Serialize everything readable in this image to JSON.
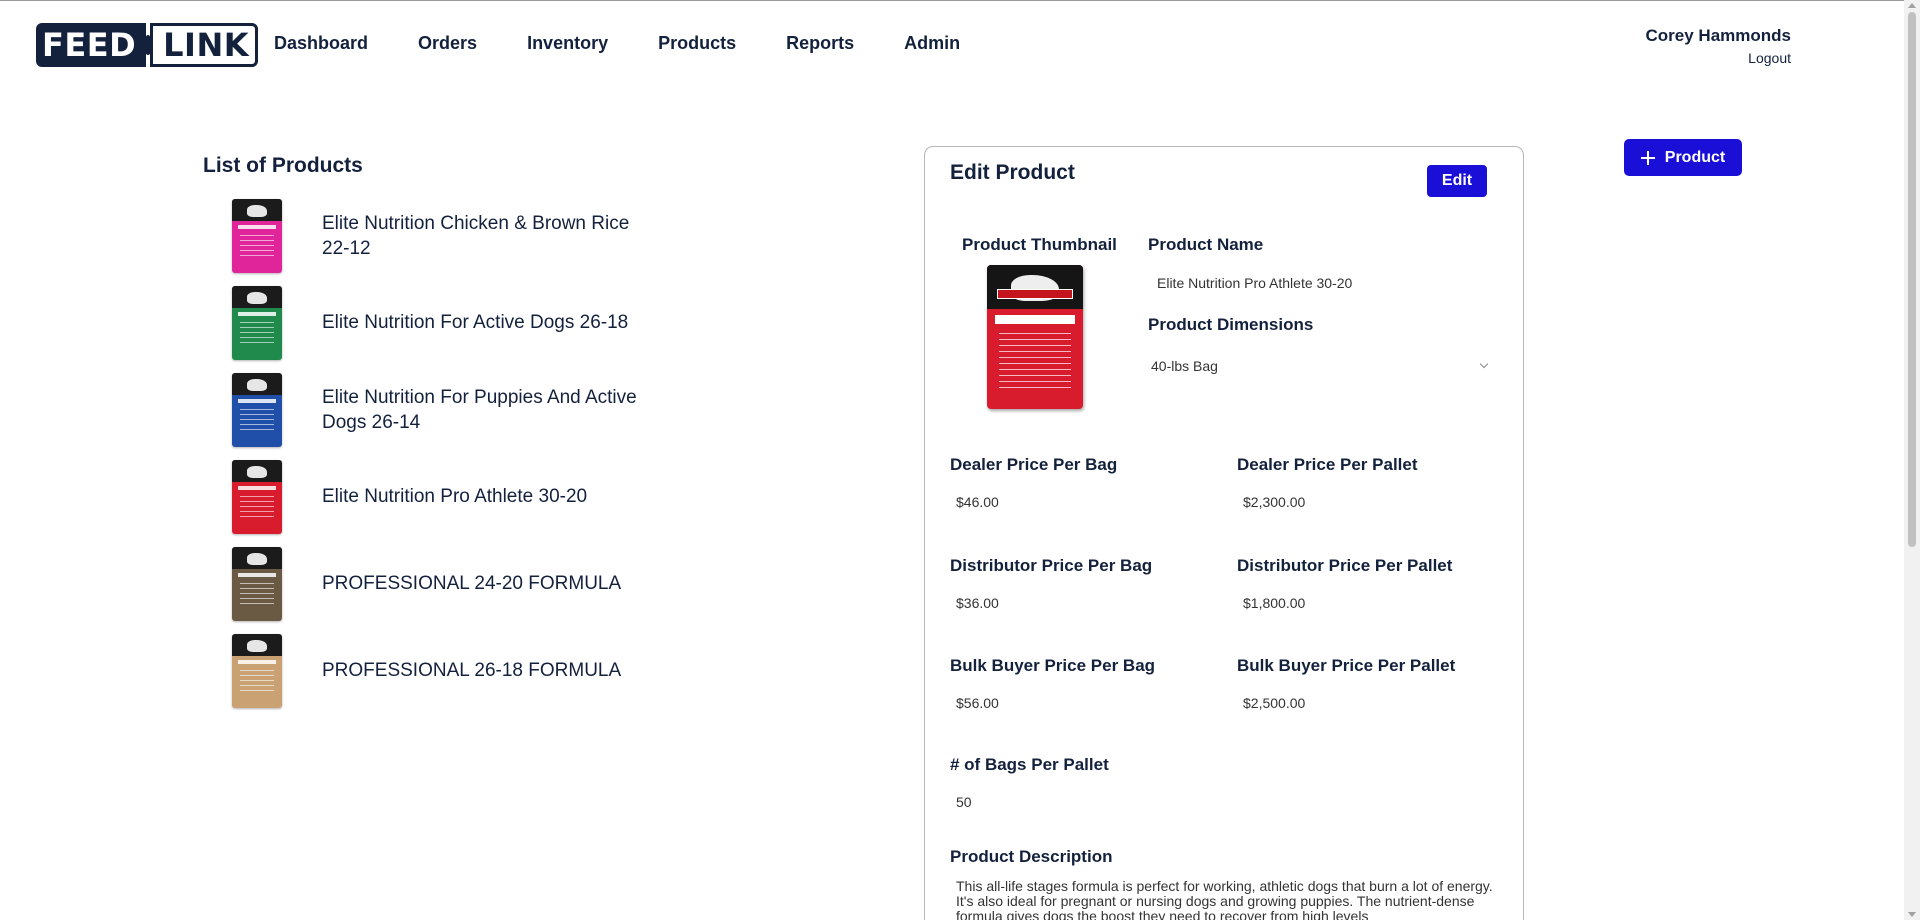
{
  "brand": {
    "part1": "FEED",
    "part2": "LINK"
  },
  "nav": [
    {
      "label": "Dashboard"
    },
    {
      "label": "Orders"
    },
    {
      "label": "Inventory"
    },
    {
      "label": "Products"
    },
    {
      "label": "Reports"
    },
    {
      "label": "Admin"
    }
  ],
  "user": {
    "name": "Corey Hammonds",
    "logout": "Logout"
  },
  "product_list": {
    "title": "List of Products",
    "items": [
      {
        "name": "Elite Nutrition Chicken & Brown Rice 22-12",
        "bag_color": "#e0259b"
      },
      {
        "name": " Elite Nutrition For Active Dogs 26-18",
        "bag_color": "#1f8a4c"
      },
      {
        "name": " Elite Nutrition For Puppies And Active Dogs 26-14",
        "bag_color": "#1f4fa8"
      },
      {
        "name": " Elite Nutrition Pro Athlete 30-20",
        "bag_color": "#d81c2e"
      },
      {
        "name": "PROFESSIONAL 24-20 FORMULA",
        "bag_color": "#6b5a43"
      },
      {
        "name": "PROFESSIONAL 26-18 FORMULA",
        "bag_color": "#c9a173"
      }
    ]
  },
  "edit_product": {
    "title": "Edit Product",
    "edit_button": "Edit",
    "thumbnail_label": "Product Thumbnail",
    "name_label": "Product Name",
    "name_value": "Elite Nutrition Pro Athlete 30-20",
    "dimensions_label": "Product Dimensions",
    "dimensions_value": "40-lbs Bag",
    "dealer_bag_label": "Dealer Price Per Bag",
    "dealer_bag_value": "$46.00",
    "dealer_pallet_label": "Dealer Price Per Pallet",
    "dealer_pallet_value": "$2,300.00",
    "distributor_bag_label": "Distributor Price Per Bag",
    "distributor_bag_value": "$36.00",
    "distributor_pallet_label": "Distributor Price Per Pallet",
    "distributor_pallet_value": "$1,800.00",
    "bulk_bag_label": "Bulk Buyer Price Per Bag",
    "bulk_bag_value": "$56.00",
    "bulk_pallet_label": "Bulk Buyer Price Per Pallet",
    "bulk_pallet_value": "$2,500.00",
    "bags_per_pallet_label": "# of Bags Per Pallet",
    "bags_per_pallet_value": "50",
    "description_label": "Product Description",
    "description_value": "This all-life stages formula is perfect for working, athletic dogs that burn a lot of energy. It's also ideal for pregnant or nursing dogs and growing puppies. The nutrient-dense formula gives dogs the boost they need to recover from high levels"
  },
  "add_product_button": "Product"
}
